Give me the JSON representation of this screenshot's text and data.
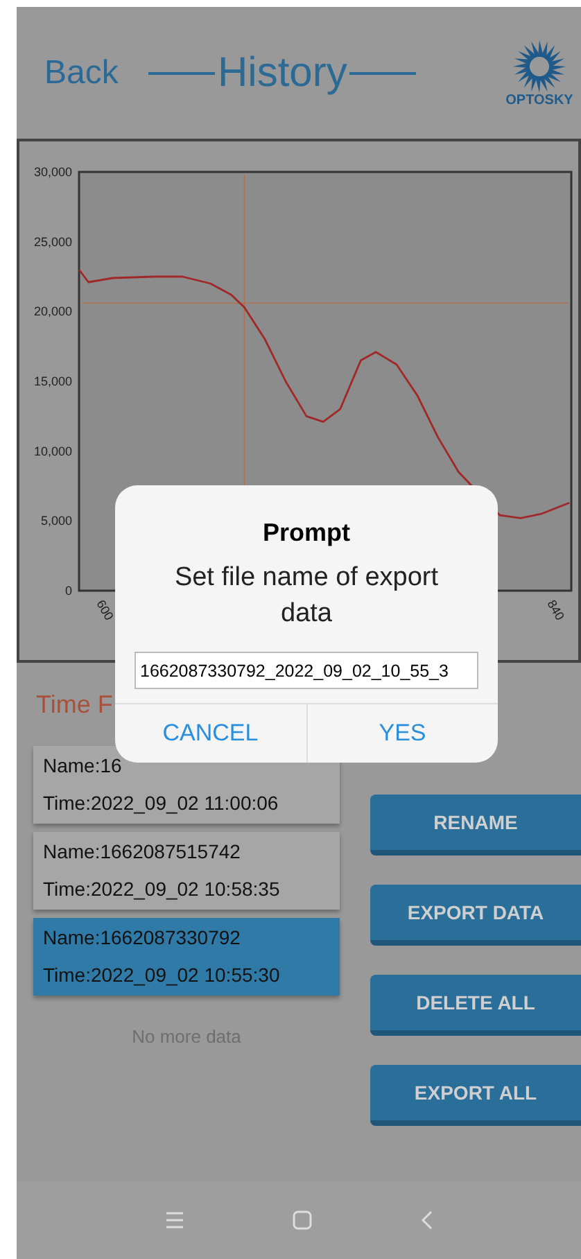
{
  "header": {
    "back": "Back",
    "title": "History",
    "logo_text": "OPTOSKY"
  },
  "chart": {
    "chart_data": {
      "type": "line",
      "x": [
        585,
        590,
        603,
        625,
        640,
        655,
        666,
        673,
        684,
        695,
        706,
        715,
        724,
        735,
        743,
        754,
        765,
        776,
        787,
        809,
        820,
        831,
        846
      ],
      "ref_lines": [
        {
          "axis": "x",
          "value": 673,
          "color": "#b07050"
        },
        {
          "axis": "y",
          "value": 20600,
          "color": "#b07050"
        }
      ],
      "series": [
        {
          "color": "#a02828",
          "values": [
            23000,
            22100,
            22400,
            22500,
            22500,
            22000,
            21200,
            20300,
            18000,
            15000,
            12500,
            12100,
            13000,
            16500,
            17100,
            16200,
            14000,
            11000,
            8500,
            5400,
            5200,
            5500,
            6300
          ]
        }
      ],
      "xlim": [
        585,
        847
      ],
      "ylim": [
        0,
        30000
      ],
      "xticks": [
        600,
        840
      ],
      "yticks": [
        {
          "value": 0,
          "label": "0"
        },
        {
          "value": 5000,
          "label": "5,000"
        },
        {
          "value": 10000,
          "label": "10,000"
        },
        {
          "value": 15000,
          "label": "15,000"
        },
        {
          "value": 20000,
          "label": "20,000"
        },
        {
          "value": 25000,
          "label": "25,000"
        },
        {
          "value": 30000,
          "label": "30,000"
        }
      ]
    }
  },
  "time_filter": {
    "label": "Time F"
  },
  "records": [
    {
      "name": "Name:16",
      "time": "Time:2022_09_02 11:00:06",
      "selected": false
    },
    {
      "name": "Name:1662087515742",
      "time": "Time:2022_09_02 10:58:35",
      "selected": false
    },
    {
      "name": "Name:1662087330792",
      "time": "Time:2022_09_02 10:55:30",
      "selected": true
    }
  ],
  "list_footer": "No more data",
  "actions": [
    "RENAME",
    "EXPORT DATA",
    "DELETE ALL",
    "EXPORT ALL"
  ],
  "dialog": {
    "title": "Prompt",
    "message": "Set file name of export data",
    "input_value": "1662087330792_2022_09_02_10_55_3",
    "buttons": [
      "CANCEL",
      "YES"
    ]
  }
}
